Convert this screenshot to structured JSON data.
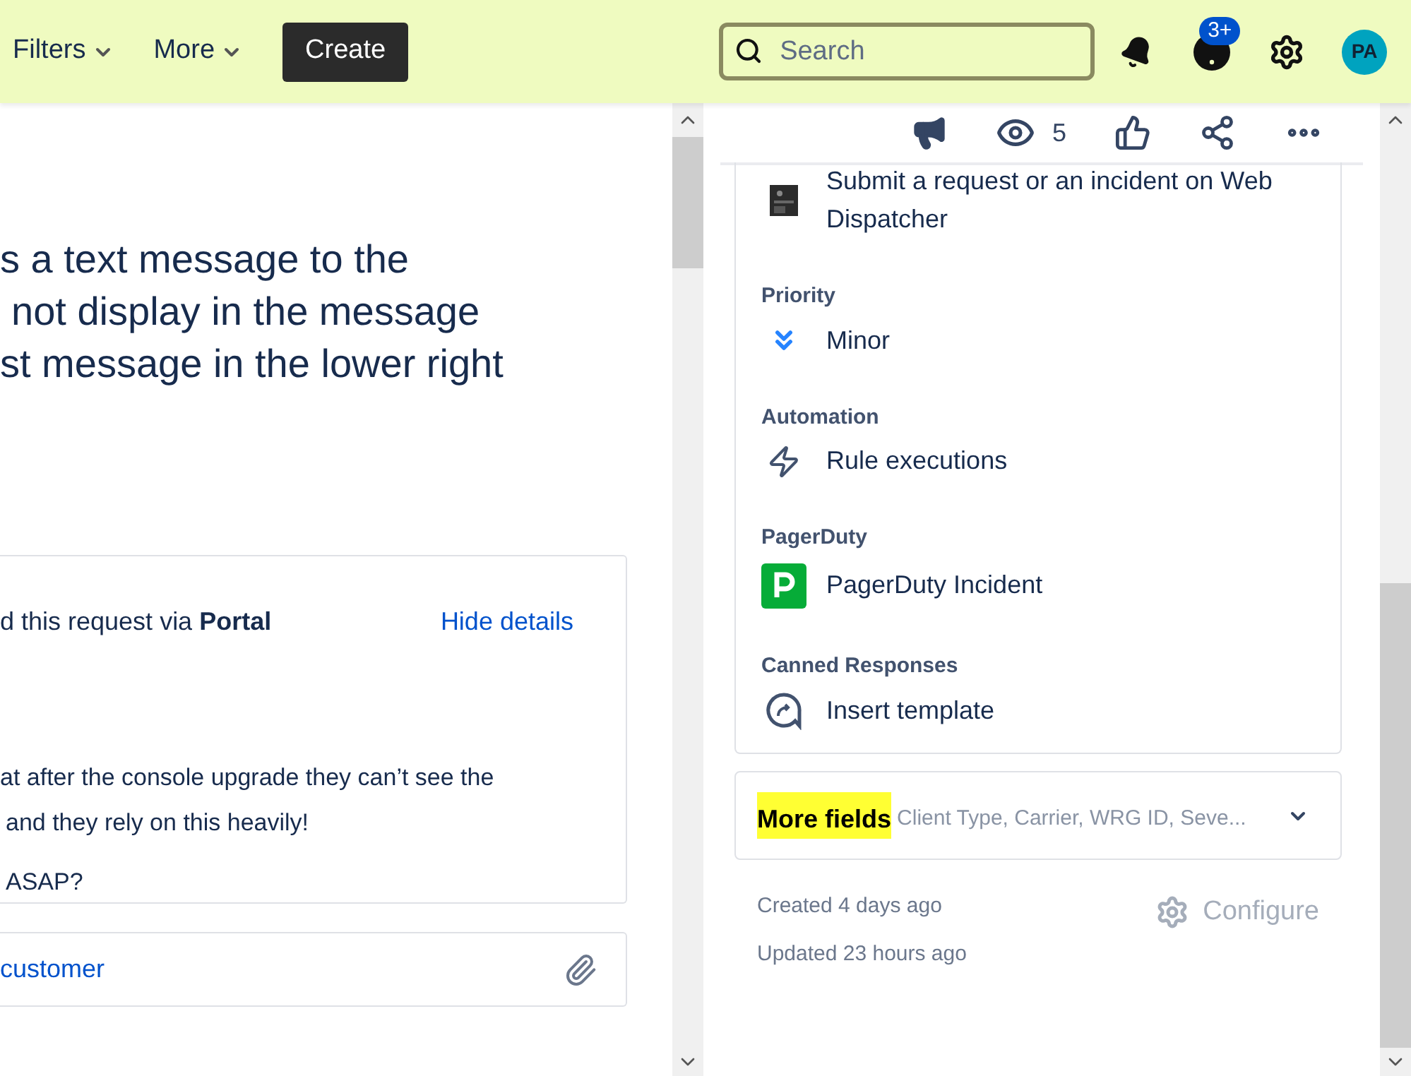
{
  "header": {
    "nav": [
      {
        "label": "Filters"
      },
      {
        "label": "More"
      }
    ],
    "create": "Create",
    "search": {
      "placeholder": "Search"
    },
    "help_badge": "3+",
    "avatar": "PA"
  },
  "issue": {
    "summary_lines": [
      "s a text message to the",
      "not display in the message",
      "st message in the lower right"
    ],
    "request_card": {
      "raised_via": "d this request via **Portal**",
      "toggle": "Hide details",
      "body_lines": [
        "at after the console upgrade they can’t see the",
        "and they rely on this heavily!",
        "ASAP?"
      ]
    },
    "reply": {
      "link": "customer"
    }
  },
  "actions": {
    "watchers": "5"
  },
  "fields": [
    {
      "kind": "request_type",
      "value": "Submit a request or an incident on Web Dispatcher"
    },
    {
      "kind": "priority",
      "label": "Priority",
      "value": "Minor"
    },
    {
      "kind": "automation",
      "label": "Automation",
      "value": "Rule executions"
    },
    {
      "kind": "pagerduty",
      "label": "PagerDuty",
      "value": "PagerDuty Incident"
    },
    {
      "kind": "canned",
      "label": "Canned Responses",
      "value": "Insert template"
    }
  ],
  "more_fields": {
    "label": "More fields",
    "highlighted": true,
    "summary": "Client Type, Carrier, WRG ID, Seve..."
  },
  "footer": {
    "created": "Created 4 days ago",
    "updated": "Updated 23 hours ago",
    "configure": "Configure"
  }
}
